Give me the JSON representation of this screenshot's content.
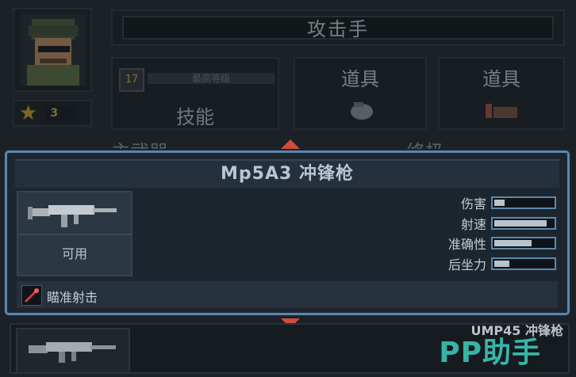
{
  "header": {
    "class_title": "攻击手",
    "stars": "3"
  },
  "skill": {
    "level": "17",
    "level_caption": "最高等级",
    "label": "技能"
  },
  "items": [
    {
      "label": "道具",
      "icon": "grenade-icon"
    },
    {
      "label": "道具",
      "icon": "ammo-icon"
    }
  ],
  "background_tabs": {
    "left": "主武器",
    "right": "终极"
  },
  "weapon": {
    "name": "Mp5A3 冲锋枪",
    "status": "可用",
    "stats": [
      {
        "name": "伤害",
        "value": 0.22
      },
      {
        "name": "射速",
        "value": 0.9
      },
      {
        "name": "准确性",
        "value": 0.65
      },
      {
        "name": "后坐力",
        "value": 0.3
      }
    ],
    "ability": "瞄准射击",
    "ability_icon": "crosshair-icon"
  },
  "next_weapon": {
    "name": "UMP45 冲锋枪"
  },
  "watermark": "PP助手",
  "colors": {
    "card_border": "#5a88ae",
    "arrow": "#d24a3a",
    "watermark": "#3cc5b5"
  }
}
